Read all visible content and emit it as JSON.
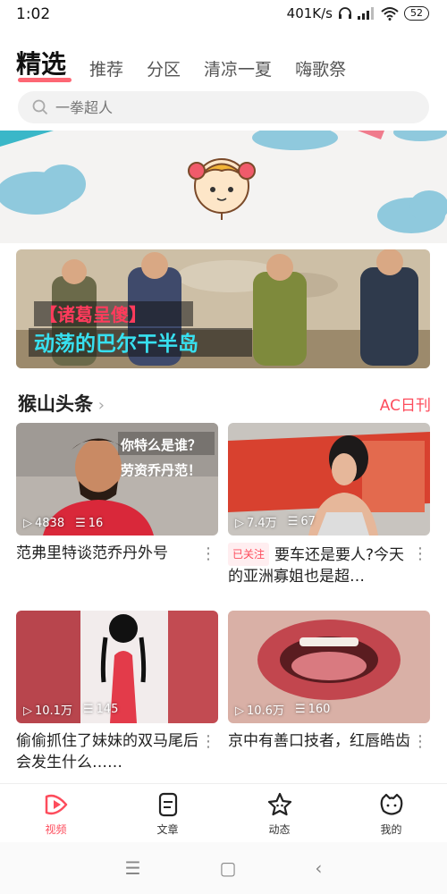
{
  "status": {
    "time": "1:02",
    "speed": "401K/s",
    "battery": "52"
  },
  "tabs": [
    {
      "label": "精选",
      "active": true
    },
    {
      "label": "推荐"
    },
    {
      "label": "分区"
    },
    {
      "label": "清凉一夏"
    },
    {
      "label": "嗨歌祭"
    }
  ],
  "search": {
    "placeholder": "一拳超人"
  },
  "banner": {
    "line1": "【诸葛呈傻】",
    "line2": "动荡的巴尔干半岛"
  },
  "section": {
    "title": "猴山头条",
    "link": "AC日刊"
  },
  "cards": [
    {
      "views": "4838",
      "comments": "16",
      "caption": "范弗里特谈范乔丹外号",
      "overlay1": "你特么是谁？",
      "overlay2": "劳资乔丹范！"
    },
    {
      "views": "7.4万",
      "comments": "67",
      "tag": "已关注",
      "caption": "要车还是要人?今天的亚洲寡姐也是超…"
    },
    {
      "views": "10.1万",
      "comments": "145",
      "caption": "偷偷抓住了妹妹的双马尾后会发生什么……"
    },
    {
      "views": "10.6万",
      "comments": "160",
      "caption": "京中有善口技者，红唇皓齿"
    }
  ],
  "nav": [
    {
      "label": "视频",
      "icon": "video-icon",
      "active": true
    },
    {
      "label": "文章",
      "icon": "article-icon"
    },
    {
      "label": "动态",
      "icon": "star-icon"
    },
    {
      "label": "我的",
      "icon": "profile-icon"
    }
  ],
  "colors": {
    "accent": "#fd4c5c"
  }
}
